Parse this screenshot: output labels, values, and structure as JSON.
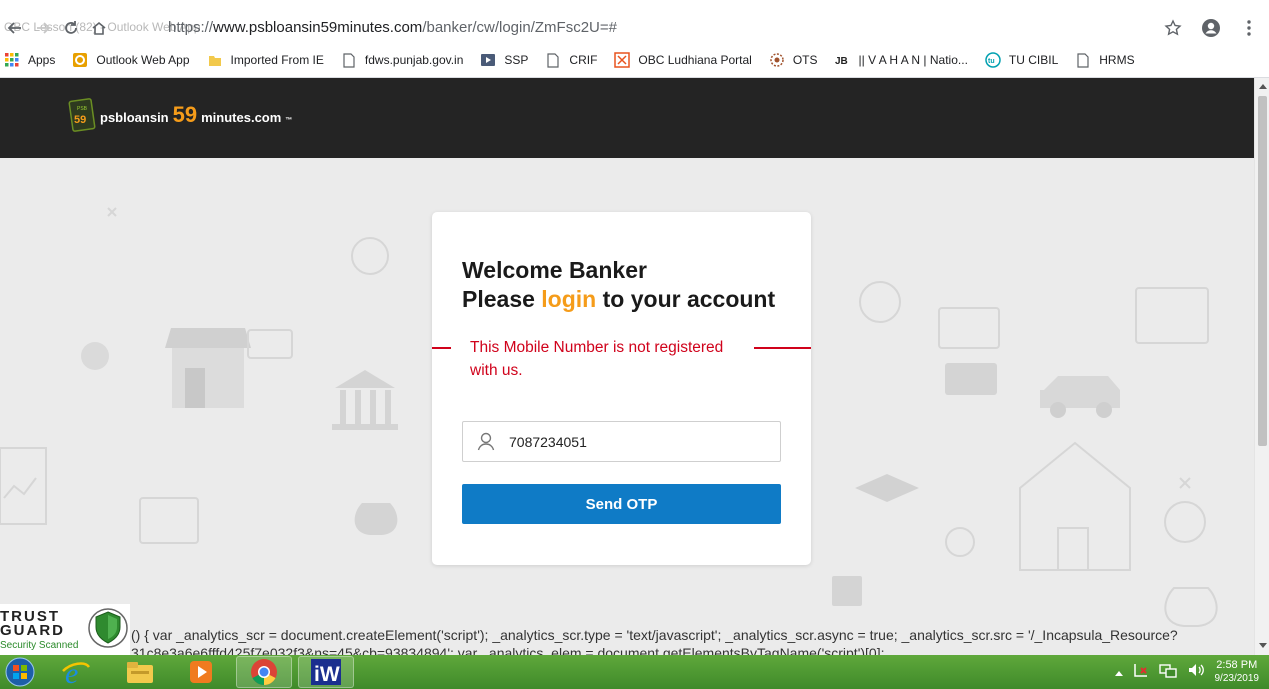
{
  "browser": {
    "ghost_tab_text": "OBC Lesson (82) - Outlook Web App",
    "url_prefix": "https://",
    "url_main": "www.psbloansin59minutes.com",
    "url_path": "/banker/cw/login/ZmFsc2U=#"
  },
  "bookmarks": [
    {
      "label": "Apps",
      "icon": "apps-grid-icon"
    },
    {
      "label": "Outlook Web App",
      "icon": "outlook-icon"
    },
    {
      "label": "Imported From IE",
      "icon": "folder-icon"
    },
    {
      "label": "fdws.punjab.gov.in",
      "icon": "page-icon"
    },
    {
      "label": "SSP",
      "icon": "ssp-icon"
    },
    {
      "label": "CRIF",
      "icon": "page-icon"
    },
    {
      "label": "OBC Ludhiana Portal",
      "icon": "obc-icon"
    },
    {
      "label": "OTS",
      "icon": "ots-icon"
    },
    {
      "label": "|| V A H A N | Natio...",
      "icon": "vahan-icon"
    },
    {
      "label": "TU CIBIL",
      "icon": "cibil-icon"
    },
    {
      "label": "HRMS",
      "icon": "page-icon"
    }
  ],
  "site": {
    "logo_psb": "PSB",
    "logo_mark_num": "59",
    "logo_prefix": "psbloansin",
    "logo_number": "59",
    "logo_suffix": "minutes.com",
    "logo_tm": "™"
  },
  "login": {
    "title_line1": "Welcome Banker",
    "title_line2_pre": "Please ",
    "title_line2_accent": "login",
    "title_line2_post": " to your account",
    "error_message": "This Mobile Number is not registered with us.",
    "mobile_value": "7087234051",
    "send_otp_label": "Send OTP"
  },
  "trust_guard": {
    "line1": "TRUST",
    "line2": "GUARD",
    "subtitle": "Security Scanned"
  },
  "script_leak": {
    "line1": "() { var _analytics_scr = document.createElement('script'); _analytics_scr.type = 'text/javascript'; _analytics_scr.async = true; _analytics_scr.src = '/_Incapsula_Resource?",
    "line2": "31c8e3a6e6fffd425f7e032f3&ns=45&cb=93834894'; var _analytics_elem = document.getElementsByTagName('script')[0];"
  },
  "taskbar": {
    "time": "2:58 PM",
    "date": "9/23/2019"
  },
  "colors": {
    "accent": "#f59c1a",
    "error": "#d0021b",
    "button": "#0f7bc6",
    "header": "#242424"
  }
}
